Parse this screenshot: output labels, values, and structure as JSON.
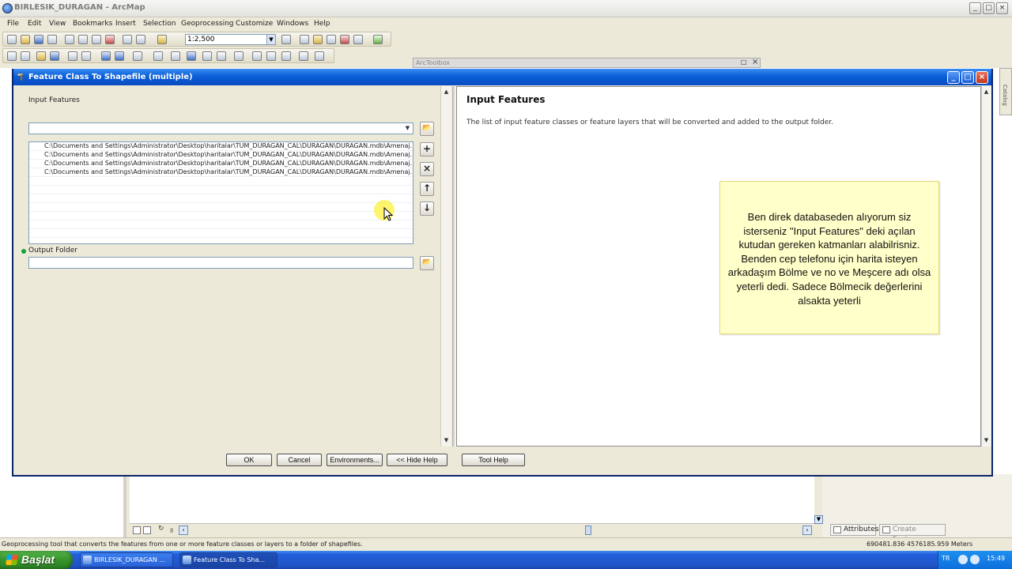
{
  "app": {
    "title": "BIRLESIK_DURAGAN - ArcMap"
  },
  "menu": [
    "File",
    "Edit",
    "View",
    "Bookmarks",
    "Insert",
    "Selection",
    "Geoprocessing",
    "Customize",
    "Windows",
    "Help"
  ],
  "toolbar": {
    "scale": "1:2,500"
  },
  "toolbox": {
    "label": "ArcToolbox"
  },
  "catalog": {
    "label": "Catalog"
  },
  "dialog": {
    "title": "Feature Class To Shapefile (multiple)",
    "input_label": "Input Features",
    "input_value": "",
    "input_items": [
      "C:\\Documents and Settings\\Administrator\\Desktop\\haritalar\\TUM_DURAGAN_CAL\\DURAGAN\\DURAGAN.mdb\\Amenaj...",
      "C:\\Documents and Settings\\Administrator\\Desktop\\haritalar\\TUM_DURAGAN_CAL\\DURAGAN\\DURAGAN.mdb\\Amenaj...",
      "C:\\Documents and Settings\\Administrator\\Desktop\\haritalar\\TUM_DURAGAN_CAL\\DURAGAN\\DURAGAN.mdb\\Amenaj...",
      "C:\\Documents and Settings\\Administrator\\Desktop\\haritalar\\TUM_DURAGAN_CAL\\DURAGAN\\DURAGAN.mdb\\Amenaj..."
    ],
    "output_label": "Output Folder",
    "output_value": "",
    "buttons": {
      "ok": "OK",
      "cancel": "Cancel",
      "environments": "Environments...",
      "hide_help": "<< Hide Help",
      "tool_help": "Tool Help"
    }
  },
  "help": {
    "title": "Input Features",
    "text": "The list of input feature classes or feature layers that will be converted and added to the output folder."
  },
  "note": {
    "text": "Ben direk databaseden alıyorum siz isterseniz \"Input Features\" deki açılan kutudan gereken katmanları alabilrisniz. Benden cep telefonu için harita  isteyen arkadaşım Bölme ve no ve Meşcere adı olsa yeterli dedi. Sadece Bölmecik değerlerini alsakta yeterli"
  },
  "status": {
    "message": "Geoprocessing tool that converts the features from one or more feature classes or layers to a folder of shapefiles.",
    "coords": "690481.836  4576185.959 Meters"
  },
  "panel_tabs": {
    "attributes": "Attributes",
    "create_features": "Create Features"
  },
  "taskbar": {
    "start": "Başlat",
    "items": [
      "BIRLESIK_DURAGAN ...",
      "Feature Class To Sha..."
    ],
    "lang": "TR",
    "clock": "15:49"
  }
}
